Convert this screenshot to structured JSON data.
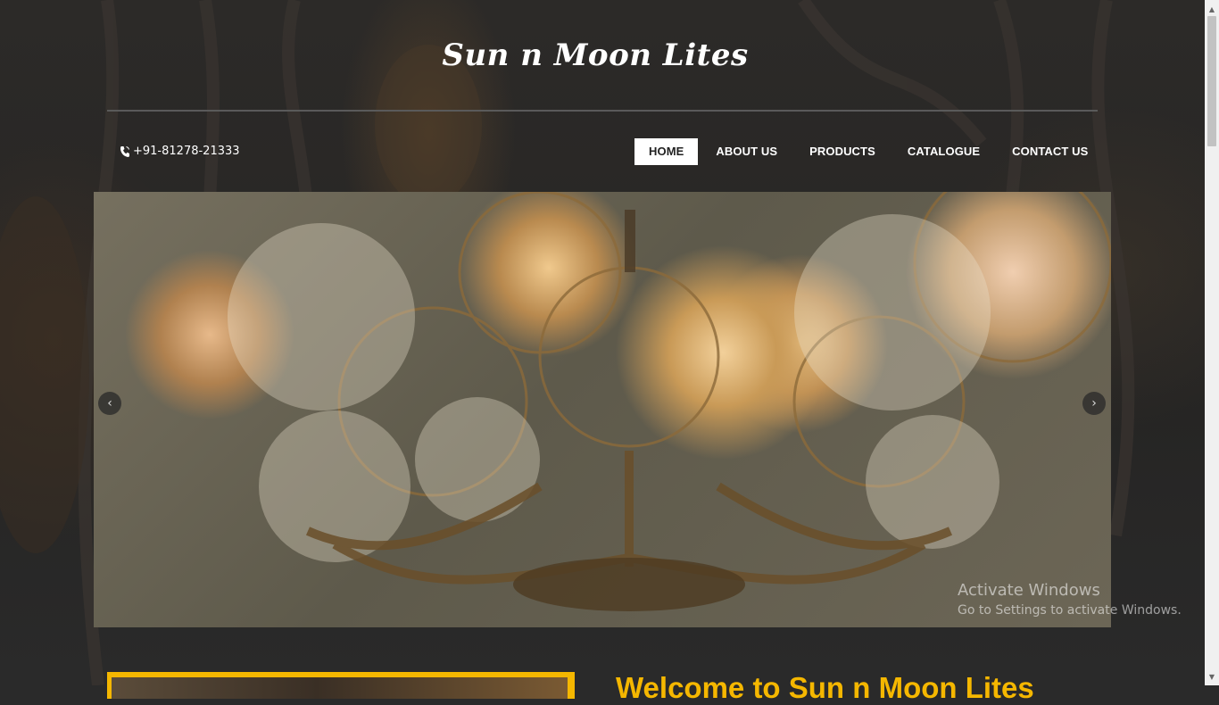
{
  "brand": {
    "logo_text": "Sun n Moon Lites"
  },
  "header": {
    "phone": "+91-81278-21333",
    "phone_icon": "phone-icon"
  },
  "nav": {
    "items": [
      {
        "label": "HOME",
        "active": true
      },
      {
        "label": "ABOUT US",
        "active": false
      },
      {
        "label": "PRODUCTS",
        "active": false
      },
      {
        "label": "CATALOGUE",
        "active": false
      },
      {
        "label": "CONTACT US",
        "active": false
      }
    ]
  },
  "slider": {
    "prev_icon": "chevron-left-icon",
    "next_icon": "chevron-right-icon",
    "prev_glyph": "‹",
    "next_glyph": "›"
  },
  "welcome": {
    "heading": "Welcome to Sun n Moon Lites"
  },
  "os_watermark": {
    "title": "Activate Windows",
    "subtitle": "Go to Settings to activate Windows."
  },
  "colors": {
    "accent": "#f5b700",
    "background": "#2a2a2a",
    "nav_active_bg": "#ffffff"
  },
  "scrollbar": {
    "up_glyph": "▲",
    "down_glyph": "▼"
  }
}
